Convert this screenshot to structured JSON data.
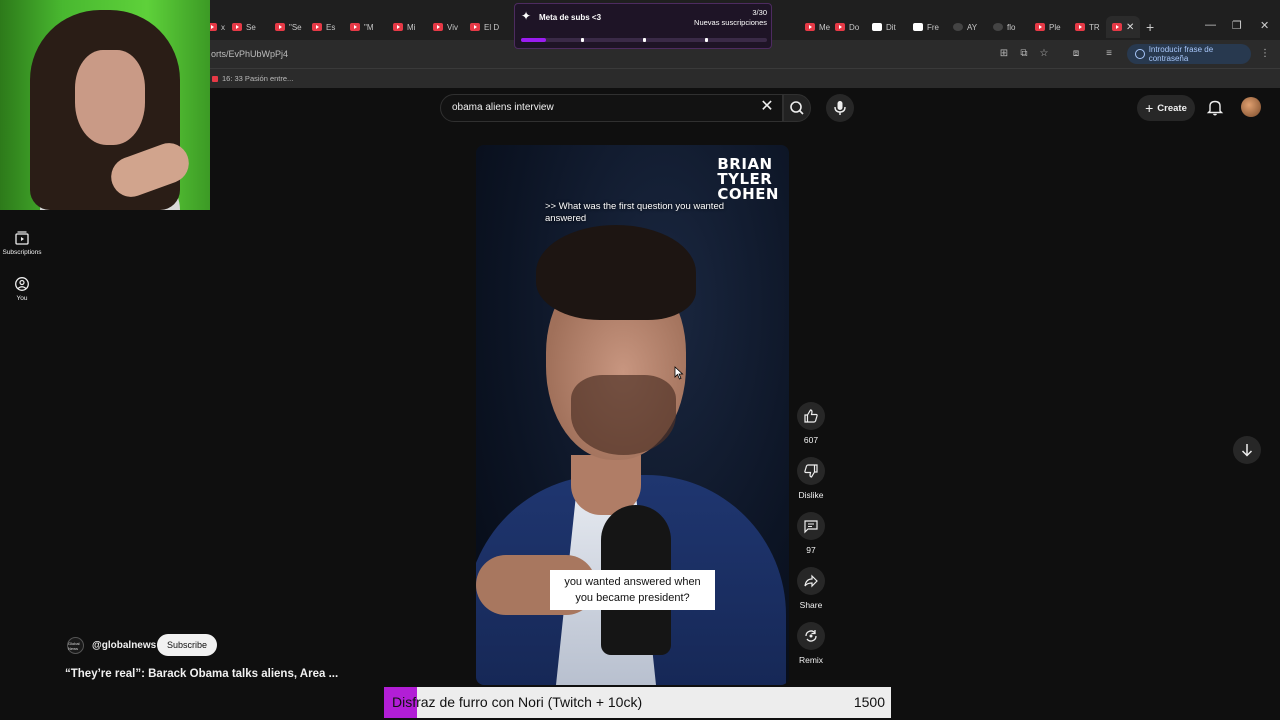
{
  "browser": {
    "tabs": [
      {
        "label": "x",
        "icon": "youtube-icon"
      },
      {
        "label": "Se",
        "icon": "youtube-icon"
      },
      {
        "label": "\"Se",
        "icon": "youtube-icon"
      },
      {
        "label": "Es",
        "icon": "youtube-icon"
      },
      {
        "label": "\"M",
        "icon": "youtube-icon"
      },
      {
        "label": "Mi",
        "icon": "youtube-icon"
      },
      {
        "label": "Viv",
        "icon": "youtube-icon"
      },
      {
        "label": "El D",
        "icon": "youtube-icon"
      },
      {
        "label": "Me",
        "icon": "youtube-icon"
      },
      {
        "label": "Do",
        "icon": "youtube-icon"
      },
      {
        "label": "Dit",
        "icon": "page-icon"
      },
      {
        "label": "Fre",
        "icon": "page-icon"
      },
      {
        "label": "AY",
        "icon": "globe-icon"
      },
      {
        "label": "flo",
        "icon": "google-icon"
      },
      {
        "label": "Ple",
        "icon": "youtube-icon"
      },
      {
        "label": "TR",
        "icon": "youtube-icon"
      }
    ],
    "url": "orts/EvPhUbWpPj4",
    "bookmark": "16: 33 Pasión entre...",
    "password_button": "Introducir frase de contraseña"
  },
  "sub_goal": {
    "title": "Meta de subs <3",
    "count": "3/30",
    "subtitle": "Nuevas suscripciones",
    "progress": 0.1
  },
  "header": {
    "search_value": "obama aliens interview",
    "create_label": "Create"
  },
  "sidebar": {
    "items": [
      {
        "label": "Subscriptions",
        "icon": "subscriptions-icon"
      },
      {
        "label": "You",
        "icon": "you-icon"
      }
    ]
  },
  "video": {
    "logo_lines": [
      "BRIAN",
      "TYLER",
      "COHEN"
    ],
    "question": ">> What was the first question you wanted answered",
    "caption_line1": "you wanted answered when",
    "caption_line2": "you became president?"
  },
  "actions": {
    "like_count": "607",
    "dislike_label": "Dislike",
    "comment_count": "97",
    "share_label": "Share",
    "remix_label": "Remix"
  },
  "channel": {
    "avatar_text": "Global News",
    "handle": "@globalnews",
    "subscribe_label": "Subscribe",
    "title": "“They’re real”: Barack Obama talks aliens, Area ..."
  },
  "stream_bar": {
    "text": "Disfraz de furro con Nori (Twitch + 10ck)",
    "value": "1500",
    "progress": 0.066
  },
  "colors": {
    "accent_purple": "#9b1cf2",
    "bar_fill": "#b21ed6",
    "youtube_red": "#e63946"
  }
}
